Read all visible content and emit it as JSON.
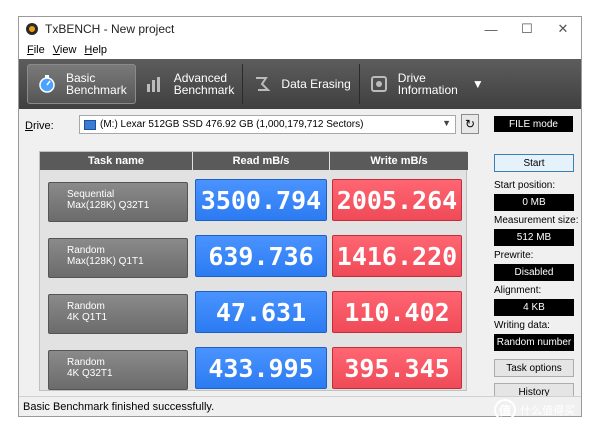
{
  "window": {
    "title": "TxBENCH - New project"
  },
  "menu": [
    "File",
    "View",
    "Help"
  ],
  "toolbar": {
    "items": [
      {
        "label": "Basic\nBenchmark",
        "icon": "stopwatch-icon",
        "active": true
      },
      {
        "label": "Advanced\nBenchmark",
        "icon": "bar-chart-icon",
        "active": false
      },
      {
        "label": "Data Erasing",
        "icon": "eraser-icon",
        "active": false
      },
      {
        "label": "Drive\nInformation",
        "icon": "drive-info-icon",
        "active": false
      }
    ],
    "more": "▼"
  },
  "drive": {
    "label": "Drive:",
    "value": "(M:) Lexar 512GB SSD  476.92 GB (1,000,179,712 Sectors)",
    "file_mode": "FILE mode"
  },
  "grid": {
    "headers": [
      "Task name",
      "Read mB/s",
      "Write mB/s"
    ],
    "rows": [
      {
        "task": [
          "Sequential",
          "Max(128K) Q32T1"
        ],
        "read": "3500.794",
        "write": "2005.264"
      },
      {
        "task": [
          "Random",
          "Max(128K) Q1T1"
        ],
        "read": "639.736",
        "write": "1416.220"
      },
      {
        "task": [
          "Random",
          "4K Q1T1"
        ],
        "read": "47.631",
        "write": "110.402"
      },
      {
        "task": [
          "Random",
          "4K Q32T1"
        ],
        "read": "433.995",
        "write": "395.345"
      }
    ]
  },
  "side": {
    "start": "Start",
    "start_position": {
      "label": "Start position:",
      "value": "0 MB"
    },
    "measurement_size": {
      "label": "Measurement size:",
      "value": "512 MB"
    },
    "prewrite": {
      "label": "Prewrite:",
      "value": "Disabled"
    },
    "alignment": {
      "label": "Alignment:",
      "value": "4 KB"
    },
    "writing_data": {
      "label": "Writing data:",
      "value": "Random number"
    },
    "task_options": "Task options",
    "history": "History"
  },
  "status": "Basic Benchmark finished successfully.",
  "watermark": {
    "mark": "值",
    "text": "什么值得买"
  },
  "colors": {
    "read": "#2c7bf2",
    "write": "#ef4a57",
    "toolbar": "#4a4a4a"
  }
}
